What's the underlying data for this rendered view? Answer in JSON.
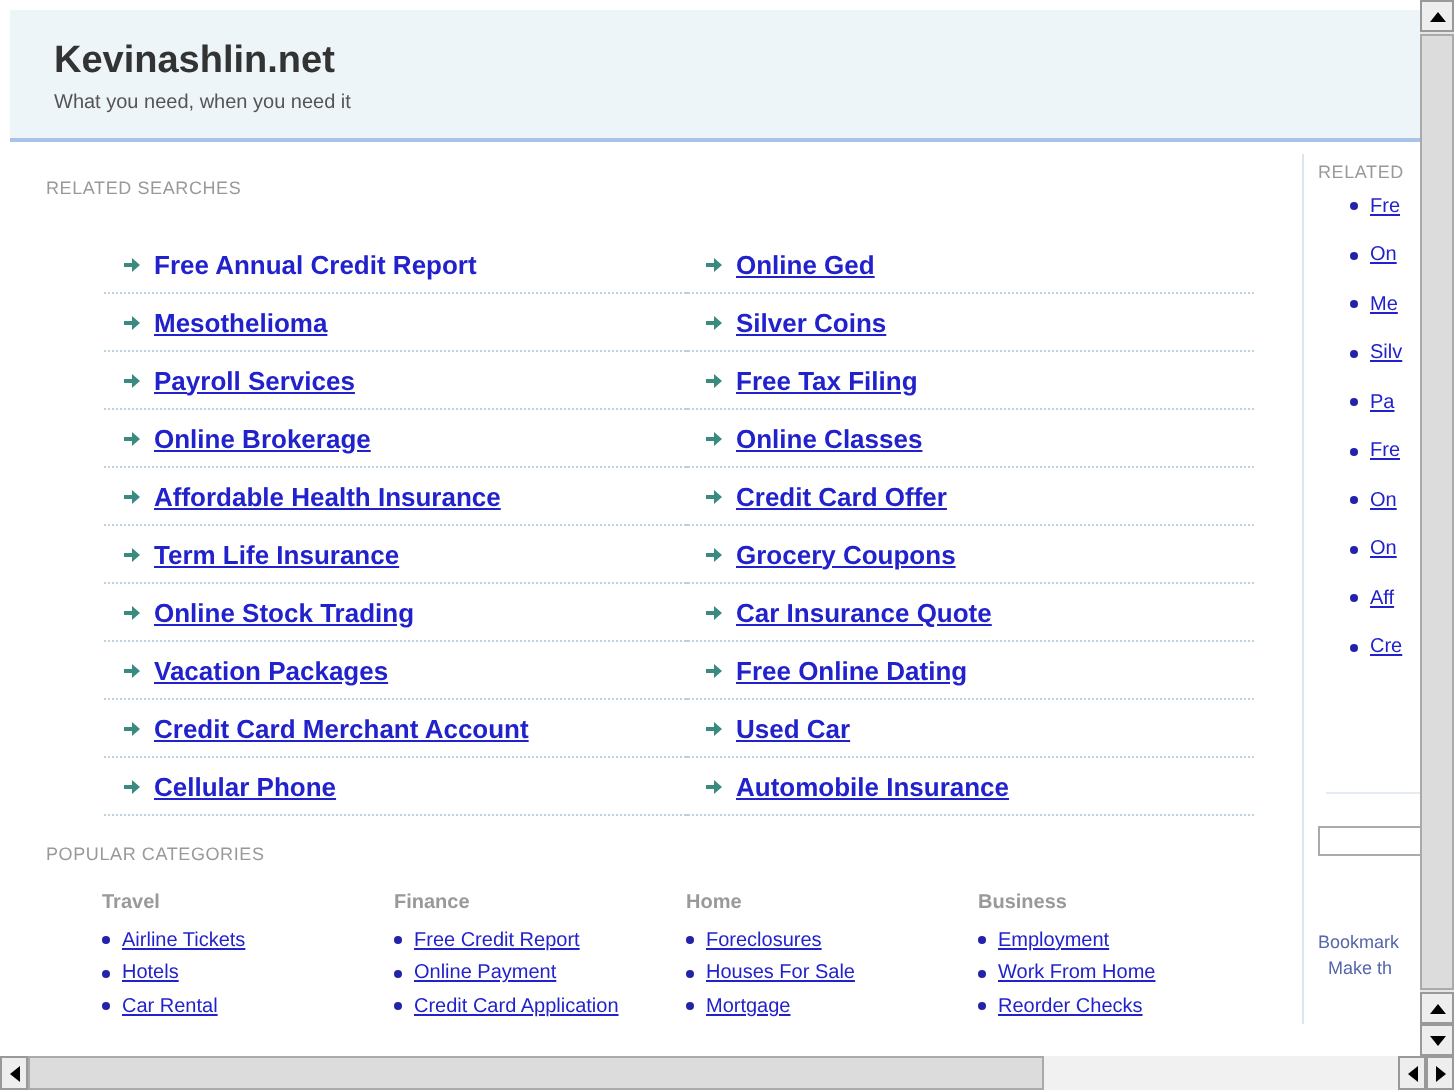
{
  "header": {
    "title": "Kevinashlin.net",
    "tagline": "What you need, when you need it"
  },
  "related": {
    "heading": "RELATED SEARCHES",
    "links": [
      {
        "text": "Free Annual Credit Report",
        "underlined": false
      },
      {
        "text": "Online Ged",
        "underlined": true
      },
      {
        "text": "Mesothelioma",
        "underlined": true
      },
      {
        "text": "Silver Coins",
        "underlined": true
      },
      {
        "text": "Payroll Services",
        "underlined": true
      },
      {
        "text": "Free Tax Filing",
        "underlined": true
      },
      {
        "text": "Online Brokerage",
        "underlined": true
      },
      {
        "text": "Online Classes",
        "underlined": true
      },
      {
        "text": "Affordable Health Insurance",
        "underlined": true
      },
      {
        "text": "Credit Card Offer",
        "underlined": true
      },
      {
        "text": "Term Life Insurance",
        "underlined": true
      },
      {
        "text": "Grocery Coupons",
        "underlined": true
      },
      {
        "text": "Online Stock Trading",
        "underlined": true
      },
      {
        "text": "Car Insurance Quote",
        "underlined": true
      },
      {
        "text": "Vacation Packages",
        "underlined": true
      },
      {
        "text": "Free Online Dating",
        "underlined": true
      },
      {
        "text": "Credit Card Merchant Account",
        "underlined": true
      },
      {
        "text": "Used Car",
        "underlined": true
      },
      {
        "text": "Cellular Phone",
        "underlined": true
      },
      {
        "text": "Automobile Insurance",
        "underlined": true
      }
    ]
  },
  "popular": {
    "heading": "POPULAR CATEGORIES",
    "categories": [
      {
        "title": "Travel",
        "links": [
          "Airline Tickets",
          "Hotels",
          "Car Rental"
        ]
      },
      {
        "title": "Finance",
        "links": [
          "Free Credit Report",
          "Online Payment",
          "Credit Card Application"
        ]
      },
      {
        "title": "Home",
        "links": [
          "Foreclosures",
          "Houses For Sale",
          "Mortgage"
        ]
      },
      {
        "title": "Business",
        "links": [
          "Employment",
          "Work From Home",
          "Reorder Checks"
        ]
      }
    ]
  },
  "sidebar": {
    "heading": "RELATED",
    "links": [
      "Fre",
      "On",
      "Me",
      "Silv",
      "Pa",
      "Fre",
      "On",
      "On",
      "Aff",
      "Cre"
    ],
    "bookmark": "Bookmark",
    "make": "Make th"
  }
}
